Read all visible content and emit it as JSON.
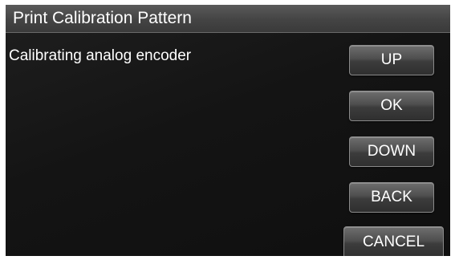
{
  "title_bar": {
    "title": "Print Calibration Pattern"
  },
  "main": {
    "message": "Calibrating analog encoder"
  },
  "buttons": {
    "up": "UP",
    "ok": "OK",
    "down": "DOWN",
    "back": "BACK",
    "cancel": "CANCEL"
  }
}
